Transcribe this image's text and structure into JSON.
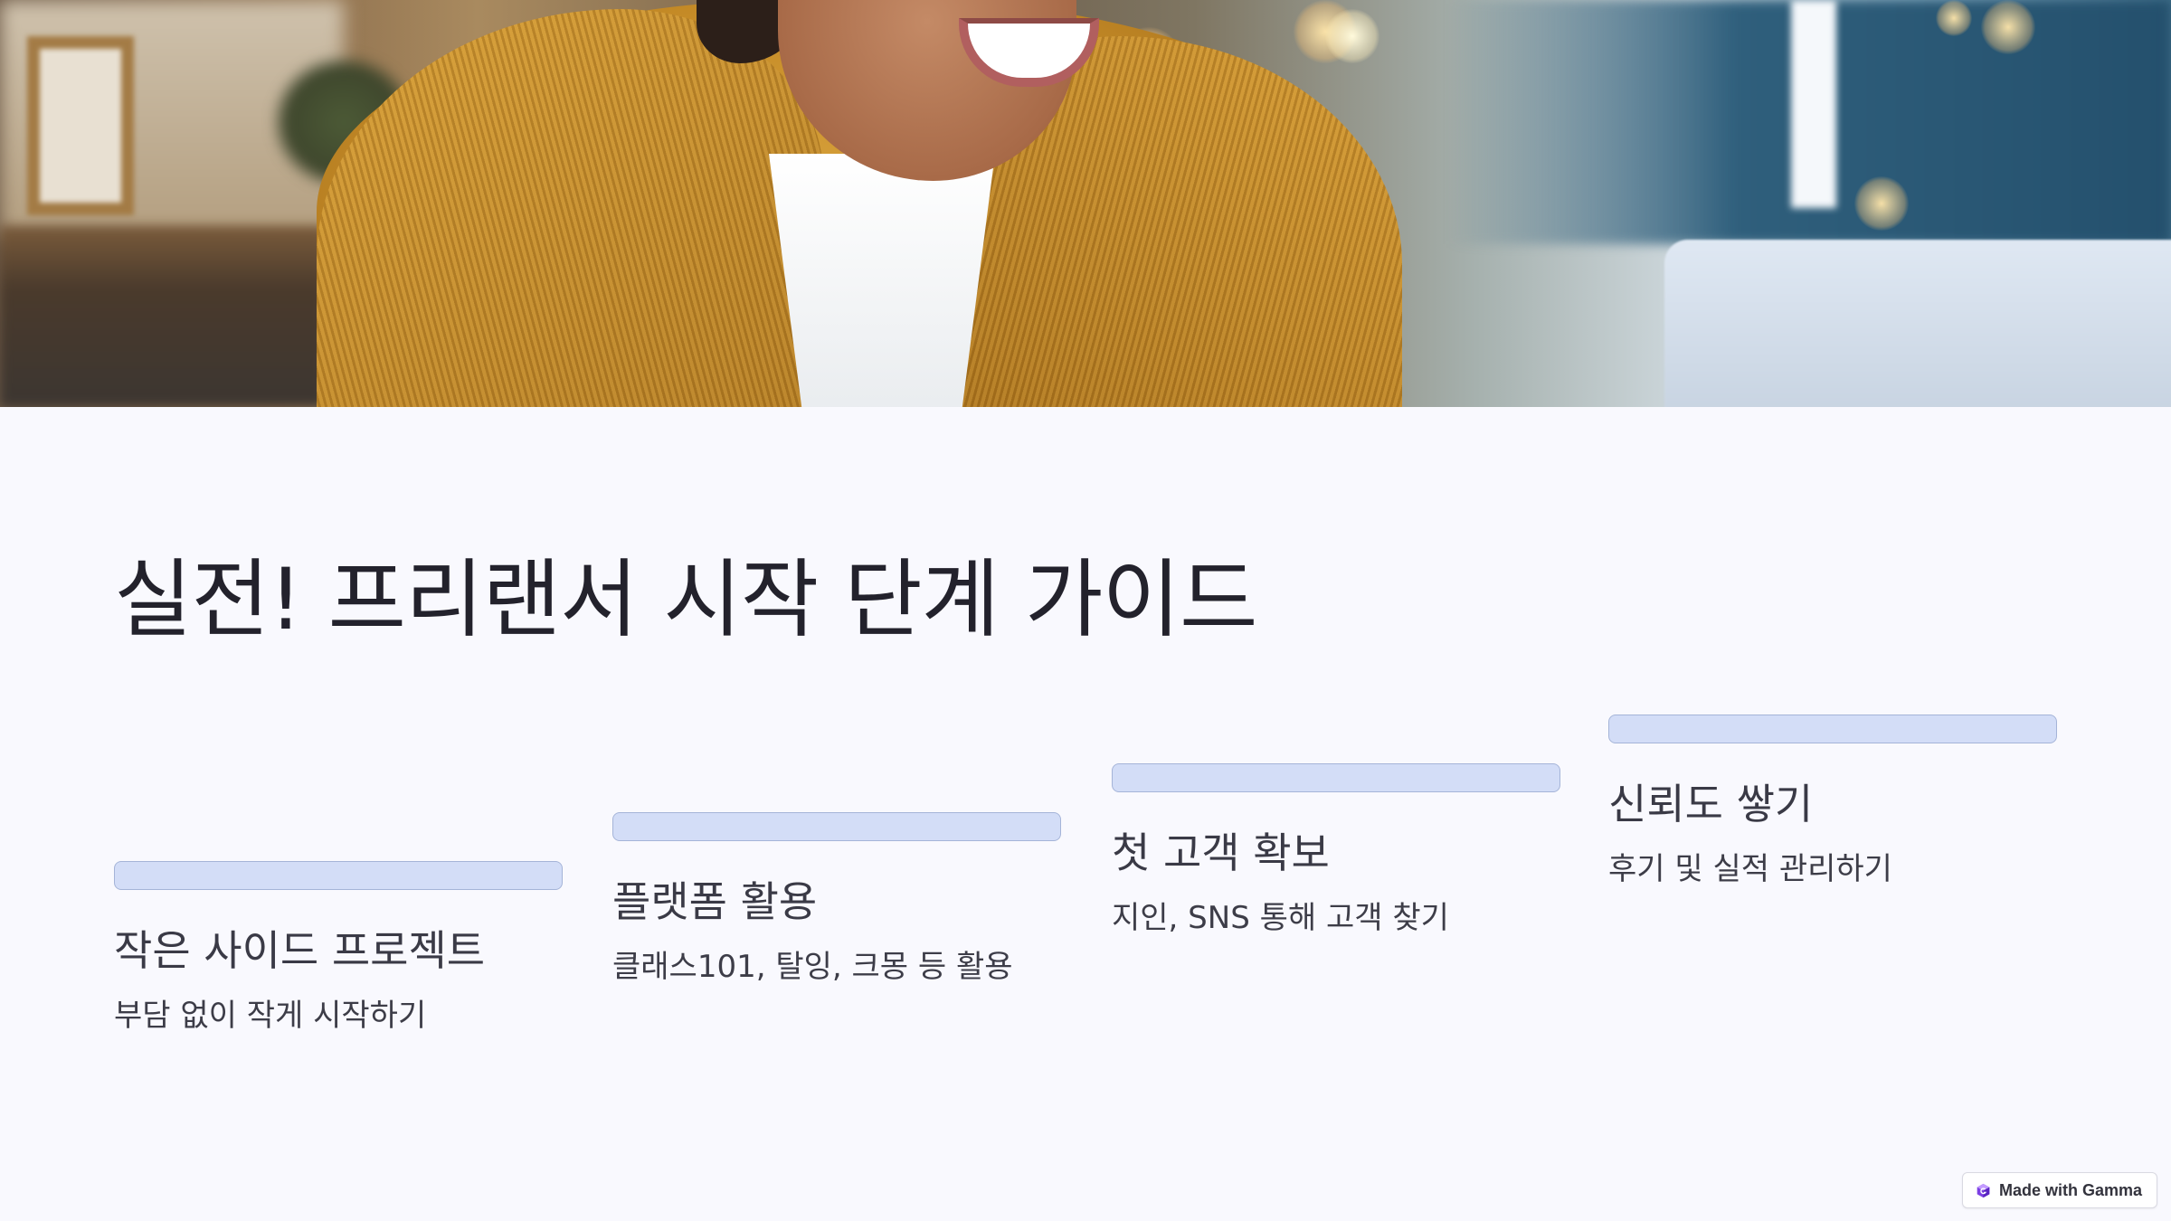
{
  "slide": {
    "title": "실전! 프리랜서 시작 단계 가이드",
    "steps": [
      {
        "title": "작은 사이드 프로젝트",
        "description": "부담 없이 작게 시작하기"
      },
      {
        "title": "플랫폼 활용",
        "description": "클래스101, 탈잉, 크몽 등 활용"
      },
      {
        "title": "첫 고객 확보",
        "description": "지인, SNS 통해 고객 찾기"
      },
      {
        "title": "신뢰도 쌓기",
        "description": "후기 및 실적 관리하기"
      }
    ]
  },
  "badge": {
    "label": "Made with Gamma",
    "icon": "gamma-logo-icon"
  },
  "colors": {
    "background": "#f9f9fe",
    "step_bar": "#d3ddf7",
    "step_bar_border": "#a5b4d8",
    "title_text": "#23222c",
    "body_text": "#3d3d48",
    "accent_purple": "#7b3fe4"
  }
}
